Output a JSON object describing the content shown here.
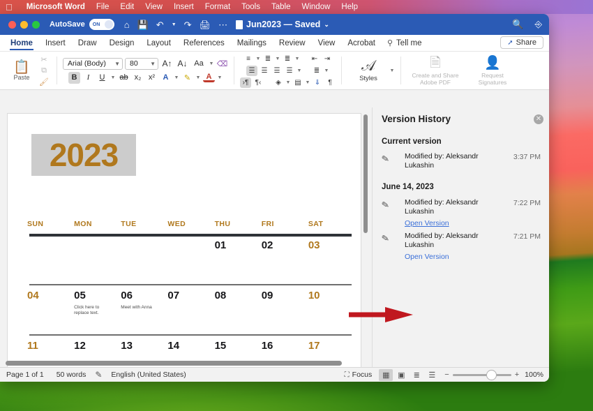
{
  "menubar": {
    "apple_icon": "apple-logo",
    "app_name": "Microsoft Word",
    "items": [
      "File",
      "Edit",
      "View",
      "Insert",
      "Format",
      "Tools",
      "Table",
      "Window",
      "Help"
    ]
  },
  "titlebar": {
    "autosave_label": "AutoSave",
    "autosave_state": "ON",
    "icons": [
      "home-icon",
      "save-icon",
      "undo-icon",
      "undo-dropdown",
      "redo-icon",
      "print-icon",
      "more-options-icon"
    ],
    "doc_title": "Jun2023 — Saved",
    "doc_title_chevron": "⌄",
    "search_icon": "search-icon",
    "account_icon": "account-icon"
  },
  "ribbon_tabs": {
    "items": [
      "Home",
      "Insert",
      "Draw",
      "Design",
      "Layout",
      "References",
      "Mailings",
      "Review",
      "View",
      "Acrobat"
    ],
    "active": "Home",
    "tellme_label": "Tell me",
    "tellme_icon": "lightbulb-icon",
    "share_label": "Share",
    "share_icon": "share-icon"
  },
  "ribbon": {
    "paste_label": "Paste",
    "paste_icon": "clipboard-icon",
    "cut_icon": "scissors-icon",
    "copy_icon": "copy-icon",
    "format_painter_icon": "paintbrush-icon",
    "font_name": "Arial (Body)",
    "font_size": "80",
    "grow_font_icon": "grow-font-icon",
    "shrink_font_icon": "shrink-font-icon",
    "change_case_label": "Aa",
    "clear_formatting_icon": "clear-formatting-icon",
    "bold": "B",
    "italic": "I",
    "underline": "U",
    "strikethrough_icon": "strikethrough-icon",
    "subscript": "x₂",
    "superscript": "x²",
    "text_effects_icon": "text-effects-icon",
    "highlight_icon": "highlight-icon",
    "font_color_icon": "font-color-icon",
    "bullets_icon": "bullets-icon",
    "numbering_icon": "numbering-icon",
    "multilevel_icon": "multilevel-list-icon",
    "decrease_indent_icon": "decrease-indent-icon",
    "increase_indent_icon": "increase-indent-icon",
    "align_left_icon": "align-left-icon",
    "align_center_icon": "align-center-icon",
    "align_right_icon": "align-right-icon",
    "justify_icon": "justify-icon",
    "line_spacing_icon": "line-spacing-icon",
    "ltr_icon": "left-to-right-icon",
    "rtl_icon": "right-to-left-icon",
    "shading_icon": "shading-icon",
    "borders_icon": "borders-icon",
    "sort_icon": "sort-icon",
    "show_marks_icon": "show-formatting-marks-icon",
    "styles_label": "Styles",
    "styles_icon": "styles-icon",
    "adobe_pdf_label": "Create and Share\nAdobe PDF",
    "adobe_pdf_line1": "Create and Share",
    "adobe_pdf_line2": "Adobe PDF",
    "adobe_pdf_icon": "pdf-upload-icon",
    "signatures_line1": "Request",
    "signatures_line2": "Signatures",
    "signatures_icon": "signature-person-icon"
  },
  "document": {
    "year": "2023",
    "day_names": [
      "SUN",
      "MON",
      "TUE",
      "WED",
      "THU",
      "FRI",
      "SAT"
    ],
    "weeks": [
      {
        "cells": [
          {
            "num": "",
            "weekend": false,
            "note": ""
          },
          {
            "num": "",
            "weekend": false,
            "note": ""
          },
          {
            "num": "",
            "weekend": false,
            "note": ""
          },
          {
            "num": "",
            "weekend": false,
            "note": ""
          },
          {
            "num": "01",
            "weekend": false,
            "note": ""
          },
          {
            "num": "02",
            "weekend": false,
            "note": ""
          },
          {
            "num": "03",
            "weekend": true,
            "note": ""
          }
        ]
      },
      {
        "cells": [
          {
            "num": "04",
            "weekend": true,
            "note": ""
          },
          {
            "num": "05",
            "weekend": false,
            "note": "Click here to replace text."
          },
          {
            "num": "06",
            "weekend": false,
            "note": "Meet with Anna"
          },
          {
            "num": "07",
            "weekend": false,
            "note": ""
          },
          {
            "num": "08",
            "weekend": false,
            "note": ""
          },
          {
            "num": "09",
            "weekend": false,
            "note": ""
          },
          {
            "num": "10",
            "weekend": true,
            "note": ""
          }
        ]
      },
      {
        "cells": [
          {
            "num": "11",
            "weekend": true,
            "note": ""
          },
          {
            "num": "12",
            "weekend": false,
            "note": ""
          },
          {
            "num": "13",
            "weekend": false,
            "note": ""
          },
          {
            "num": "14",
            "weekend": false,
            "note": ""
          },
          {
            "num": "15",
            "weekend": false,
            "note": ""
          },
          {
            "num": "16",
            "weekend": false,
            "note": ""
          },
          {
            "num": "17",
            "weekend": true,
            "note": ""
          }
        ]
      }
    ]
  },
  "version_history": {
    "title": "Version History",
    "close_icon": "close-icon",
    "sections": [
      {
        "heading": "Current version",
        "entries": [
          {
            "icon": "pencil-icon",
            "modified_by": "Modified by: Aleksandr Lukashin",
            "time": "3:37 PM",
            "link": ""
          }
        ]
      },
      {
        "heading": "June 14, 2023",
        "entries": [
          {
            "icon": "pencil-icon",
            "modified_by": "Modified by: Aleksandr Lukashin",
            "time": "7:22 PM",
            "link": "Open Version"
          },
          {
            "icon": "pencil-icon",
            "modified_by": "Modified by: Aleksandr Lukashin",
            "time": "7:21 PM",
            "link": "Open Version"
          }
        ]
      }
    ]
  },
  "annotation": {
    "arrow_color": "#c0181f",
    "arrow_target": "Open Version"
  },
  "status_bar": {
    "page": "Page 1 of 1",
    "words": "50 words",
    "proofing_icon": "proofing-icon",
    "language": "English (United States)",
    "focus_label": "Focus",
    "focus_icon": "focus-icon",
    "view_print_icon": "print-layout-icon",
    "view_web_icon": "web-layout-icon",
    "view_outline_icon": "outline-icon",
    "view_draft_icon": "draft-icon",
    "zoom_out": "−",
    "zoom_in": "+",
    "zoom_level": "100%"
  }
}
